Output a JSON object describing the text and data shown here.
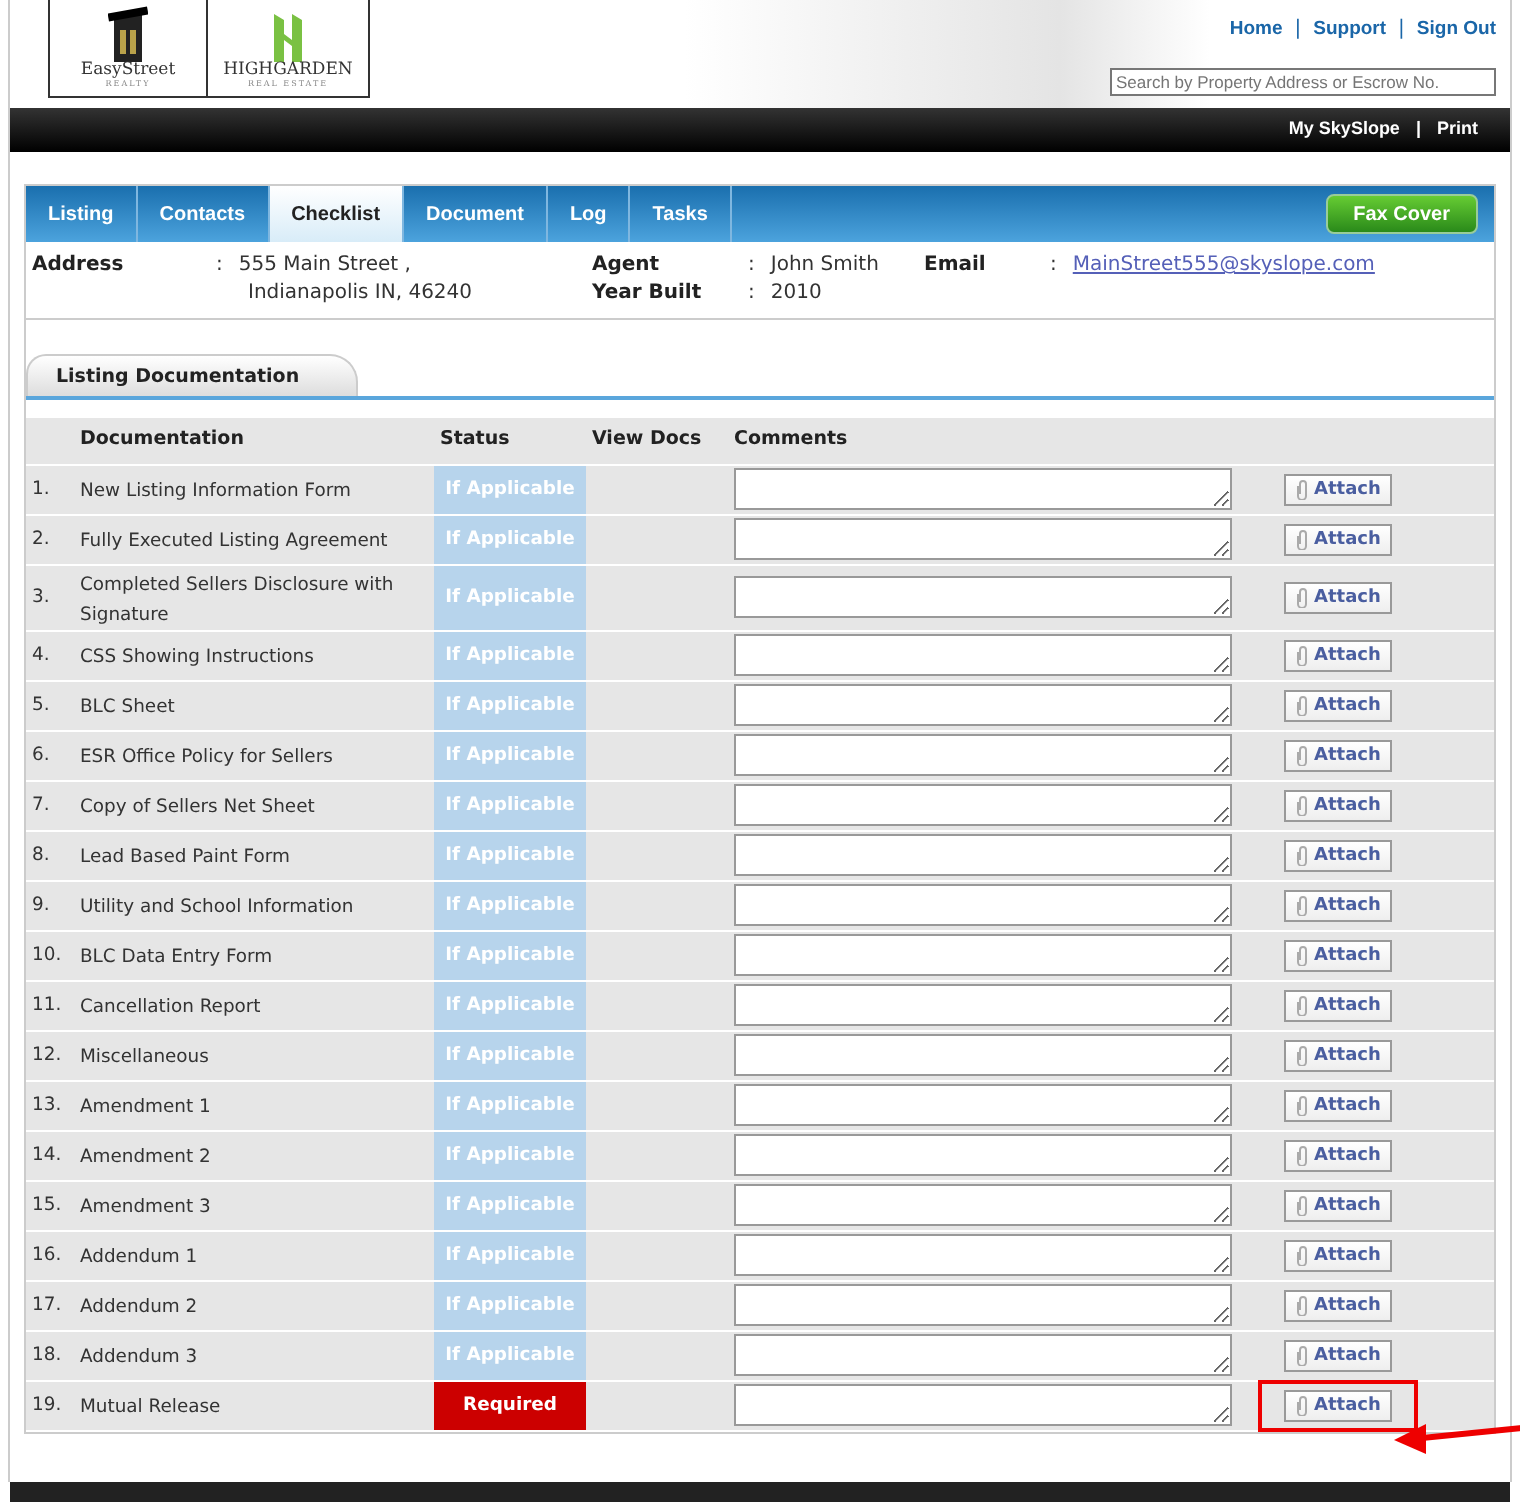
{
  "header": {
    "logos": [
      {
        "name": "EasyStreet",
        "tagline": "REALTY"
      },
      {
        "name": "HIGHGARDEN",
        "tagline": "REAL ESTATE"
      }
    ],
    "links": [
      "Home",
      "Support",
      "Sign Out"
    ],
    "separators": [
      "|",
      "|"
    ],
    "search": {
      "placeholder": "Search by Property Address or Escrow No."
    }
  },
  "top_bar": {
    "links": [
      "My SkySlope",
      "Print"
    ],
    "separators": [
      "|"
    ]
  },
  "tabs": [
    {
      "label": "Listing",
      "selected": false
    },
    {
      "label": "Contacts",
      "selected": false
    },
    {
      "label": "Checklist",
      "selected": true
    },
    {
      "label": "Document",
      "selected": false
    },
    {
      "label": "Log",
      "selected": false
    },
    {
      "label": "Tasks",
      "selected": false
    }
  ],
  "fax_button": "Fax Cover",
  "info": {
    "colons": [
      ":",
      ":",
      ":",
      ":"
    ],
    "address_label": "Address",
    "address_lines": [
      "555 Main Street ,",
      "Indianapolis IN, 46240"
    ],
    "agent_label": "Agent",
    "agent": "John Smith",
    "year_label": "Year Built",
    "year": "2010",
    "email_label": "Email",
    "email": "MainStreet555@skyslope.com"
  },
  "section_title": "Listing Documentation",
  "table": {
    "columns": [
      "Documentation",
      "Status",
      "View Docs",
      "Comments"
    ],
    "rows": [
      {
        "number": "1.",
        "document": "New Listing Information Form",
        "status": "If Applicable",
        "kind": "optional",
        "attach": "Attach",
        "highlighted": false
      },
      {
        "number": "2.",
        "document": "Fully Executed Listing Agreement",
        "status": "If Applicable",
        "kind": "optional",
        "attach": "Attach",
        "highlighted": false
      },
      {
        "number": "3.",
        "document": "Completed Sellers Disclosure with Signature",
        "status": "If Applicable",
        "kind": "optional",
        "attach": "Attach",
        "highlighted": false
      },
      {
        "number": "4.",
        "document": "CSS Showing Instructions",
        "status": "If Applicable",
        "kind": "optional",
        "attach": "Attach",
        "highlighted": false
      },
      {
        "number": "5.",
        "document": "BLC Sheet",
        "status": "If Applicable",
        "kind": "optional",
        "attach": "Attach",
        "highlighted": false
      },
      {
        "number": "6.",
        "document": "ESR Office Policy for Sellers",
        "status": "If Applicable",
        "kind": "optional",
        "attach": "Attach",
        "highlighted": false
      },
      {
        "number": "7.",
        "document": "Copy of Sellers Net Sheet",
        "status": "If Applicable",
        "kind": "optional",
        "attach": "Attach",
        "highlighted": false
      },
      {
        "number": "8.",
        "document": "Lead Based Paint Form",
        "status": "If Applicable",
        "kind": "optional",
        "attach": "Attach",
        "highlighted": false
      },
      {
        "number": "9.",
        "document": "Utility and School Information",
        "status": "If Applicable",
        "kind": "optional",
        "attach": "Attach",
        "highlighted": false
      },
      {
        "number": "10.",
        "document": "BLC Data Entry Form",
        "status": "If Applicable",
        "kind": "optional",
        "attach": "Attach",
        "highlighted": false
      },
      {
        "number": "11.",
        "document": "Cancellation Report",
        "status": "If Applicable",
        "kind": "optional",
        "attach": "Attach",
        "highlighted": false
      },
      {
        "number": "12.",
        "document": "Miscellaneous",
        "status": "If Applicable",
        "kind": "optional",
        "attach": "Attach",
        "highlighted": false
      },
      {
        "number": "13.",
        "document": "Amendment 1",
        "status": "If Applicable",
        "kind": "optional",
        "attach": "Attach",
        "highlighted": false
      },
      {
        "number": "14.",
        "document": "Amendment 2",
        "status": "If Applicable",
        "kind": "optional",
        "attach": "Attach",
        "highlighted": false
      },
      {
        "number": "15.",
        "document": "Amendment 3",
        "status": "If Applicable",
        "kind": "optional",
        "attach": "Attach",
        "highlighted": false
      },
      {
        "number": "16.",
        "document": "Addendum 1",
        "status": "If Applicable",
        "kind": "optional",
        "attach": "Attach",
        "highlighted": false
      },
      {
        "number": "17.",
        "document": "Addendum 2",
        "status": "If Applicable",
        "kind": "optional",
        "attach": "Attach",
        "highlighted": false
      },
      {
        "number": "18.",
        "document": "Addendum 3",
        "status": "If Applicable",
        "kind": "optional",
        "attach": "Attach",
        "highlighted": false
      },
      {
        "number": "19.",
        "document": "Mutual Release",
        "status": "Required",
        "kind": "required",
        "attach": "Attach",
        "highlighted": true
      }
    ]
  }
}
